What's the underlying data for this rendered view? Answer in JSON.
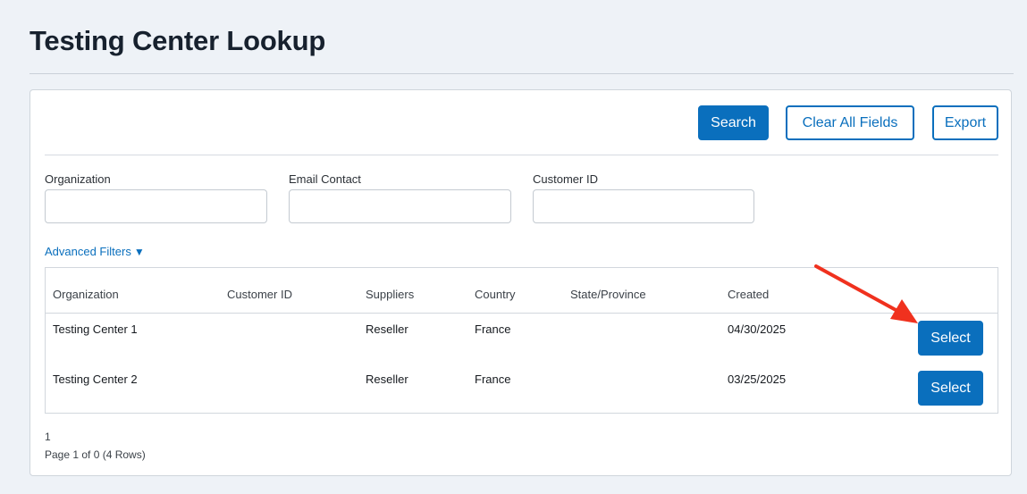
{
  "page": {
    "title": "Testing Center Lookup"
  },
  "toolbar": {
    "search_label": "Search",
    "clear_label": "Clear All Fields",
    "export_label": "Export"
  },
  "filters": {
    "organization": {
      "label": "Organization",
      "value": "",
      "placeholder": ""
    },
    "email_contact": {
      "label": "Email Contact",
      "value": "",
      "placeholder": ""
    },
    "customer_id": {
      "label": "Customer ID",
      "value": "",
      "placeholder": ""
    },
    "advanced_label": "Advanced Filters",
    "advanced_icon": "caret-down-icon"
  },
  "table": {
    "columns": [
      "Organization",
      "Customer ID",
      "Suppliers",
      "Country",
      "State/Province",
      "Created"
    ],
    "rows": [
      {
        "organization": "Testing Center 1",
        "customer_id": "",
        "suppliers": "Reseller",
        "country": "France",
        "state": "",
        "created": "04/30/2025",
        "action": "Select"
      },
      {
        "organization": "Testing Center 2",
        "customer_id": "",
        "suppliers": "Reseller",
        "country": "France",
        "state": "",
        "created": "03/25/2025",
        "action": "Select"
      }
    ]
  },
  "pagination": {
    "current_page": "1",
    "summary": "Page 1 of 0 (4 Rows)"
  },
  "annotation": {
    "type": "arrow",
    "color": "#f0311e",
    "points_to": "Select button in first row"
  },
  "colors": {
    "accent": "#0a6fbd",
    "background": "#eef2f7",
    "annotation": "#f0311e"
  }
}
